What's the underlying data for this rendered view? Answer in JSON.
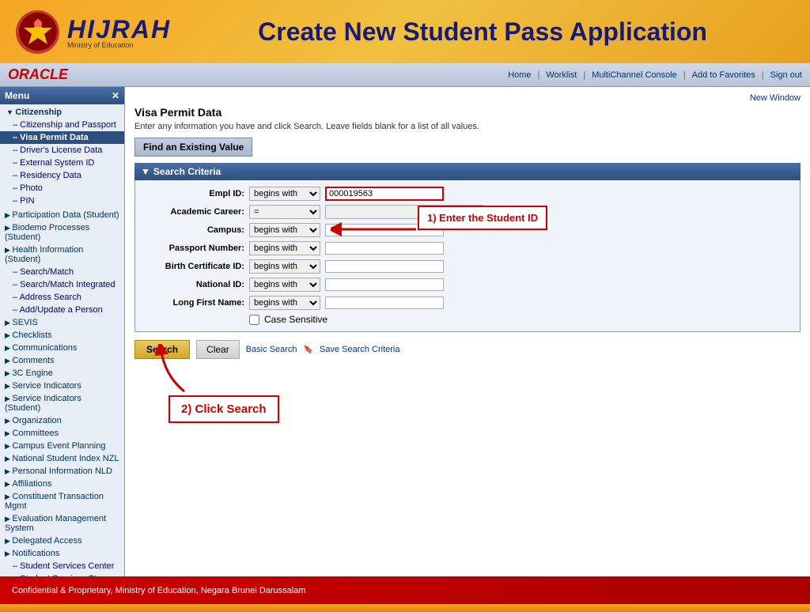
{
  "header": {
    "logo_text": "HIJRAH",
    "logo_sub": "Ministry of Education",
    "title": "Create New Student Pass Application"
  },
  "oracle_bar": {
    "logo": "ORACLE",
    "nav": {
      "home": "Home",
      "worklist": "Worklist",
      "multichannel": "MultiChannel Console",
      "add_favorites": "Add to Favorites",
      "sign_out": "Sign out"
    }
  },
  "sidebar": {
    "header": "Menu",
    "items": [
      {
        "label": "Citizenship",
        "type": "section",
        "expanded": true
      },
      {
        "label": "Citizenship and Passport",
        "type": "sub-link"
      },
      {
        "label": "Visa Permit Data",
        "type": "sub-link",
        "active": true
      },
      {
        "label": "Driver's License Data",
        "type": "sub-link"
      },
      {
        "label": "External System ID",
        "type": "sub-link"
      },
      {
        "label": "Residency Data",
        "type": "sub-link"
      },
      {
        "label": "Photo",
        "type": "sub-link"
      },
      {
        "label": "PIN",
        "type": "sub-link"
      },
      {
        "label": "Participation Data (Student)",
        "type": "group"
      },
      {
        "label": "Biodemo Processes (Student)",
        "type": "group"
      },
      {
        "label": "Health Information (Student)",
        "type": "group"
      },
      {
        "label": "Search/Match",
        "type": "sub-link"
      },
      {
        "label": "Search/Match Integrated",
        "type": "sub-link"
      },
      {
        "label": "Address Search",
        "type": "sub-link"
      },
      {
        "label": "Add/Update a Person",
        "type": "sub-link"
      },
      {
        "label": "SEVIS",
        "type": "group"
      },
      {
        "label": "Checklists",
        "type": "group"
      },
      {
        "label": "Communications",
        "type": "group"
      },
      {
        "label": "Comments",
        "type": "group"
      },
      {
        "label": "3C Engine",
        "type": "group"
      },
      {
        "label": "Service Indicators",
        "type": "group"
      },
      {
        "label": "Service Indicators (Student)",
        "type": "group"
      },
      {
        "label": "Organization",
        "type": "group"
      },
      {
        "label": "Committees",
        "type": "group"
      },
      {
        "label": "Campus Event Planning",
        "type": "group"
      },
      {
        "label": "National Student Index NZL",
        "type": "group"
      },
      {
        "label": "Personal Information NLD",
        "type": "group"
      },
      {
        "label": "Affiliations",
        "type": "group"
      },
      {
        "label": "Constituent Transaction Mgmt",
        "type": "group"
      },
      {
        "label": "Evaluation Management System",
        "type": "group"
      },
      {
        "label": "Delegated Access",
        "type": "group"
      },
      {
        "label": "Notifications",
        "type": "group"
      },
      {
        "label": "Student Services Center",
        "type": "sub-link"
      },
      {
        "label": "Student Services Ctr (Student)",
        "type": "sub-link"
      }
    ]
  },
  "content": {
    "new_window": "New Window",
    "page_title": "Visa Permit Data",
    "page_desc": "Enter any information you have and click Search. Leave fields blank for a list of all values.",
    "find_existing_btn": "Find an Existing Value",
    "search_criteria_label": "Search Criteria",
    "fields": [
      {
        "label": "Empl ID:",
        "operator": "begins with",
        "value": "000019563",
        "highlighted": true
      },
      {
        "label": "Academic Career:",
        "operator": "=",
        "value": "",
        "has_dropdown": true
      },
      {
        "label": "Campus:",
        "operator": "begins with",
        "value": ""
      },
      {
        "label": "Passport Number:",
        "operator": "begins with",
        "value": ""
      },
      {
        "label": "Birth Certificate ID:",
        "operator": "begins with",
        "value": ""
      },
      {
        "label": "National ID:",
        "operator": "begins with",
        "value": ""
      },
      {
        "label": "Long First Name:",
        "operator": "begins with",
        "value": ""
      }
    ],
    "case_sensitive": "Case Sensitive",
    "buttons": {
      "search": "Search",
      "clear": "Clear",
      "basic_search": "Basic Search",
      "save_search": "Save Search Criteria"
    }
  },
  "annotations": {
    "step1": "1) Enter the Student ID",
    "step2": "2) Click Search"
  },
  "footer": {
    "text": "Confidential & Proprietary, Ministry of Education, Negara Brunei Darussalam"
  }
}
